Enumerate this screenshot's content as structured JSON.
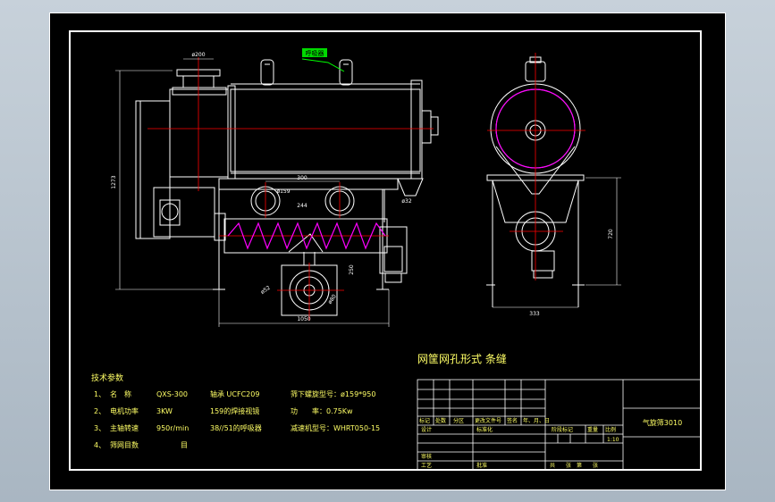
{
  "colors": {
    "background": "#000000",
    "line": "#ffffff",
    "accent": "#ff0000",
    "spiral": "#ff00ff",
    "leader": "#00ff00",
    "text": "#ffff66",
    "dim": "#00ffff",
    "window": "#b6c1cb"
  },
  "drawing": {
    "labels": {
      "top_dia": "ø200",
      "breather": "呼吸器",
      "side_height": "1273",
      "hole_spacing": "300",
      "hole_dia": "ø159",
      "inner_hole": "244",
      "right_dim": "ø32",
      "mid_dim": "250",
      "flange_dia": "ø52",
      "flange_dia2": "ø80",
      "bottom_length": "1050",
      "leg_height": "720",
      "width_dim": "333"
    },
    "screen_form": "网筐网孔形式   条缝"
  },
  "specs": {
    "title": "技术参数",
    "rows": [
      {
        "num": "1、",
        "label": "名　称",
        "value": "QXS-300",
        "extra": "轴承 UCFC209",
        "extra2": "筛下螺旋型号：ø159*950"
      },
      {
        "num": "2、",
        "label": "电机功率",
        "value": "3KW",
        "extra": "159的焊接视镜",
        "extra2": "功　　率：0.75Kw"
      },
      {
        "num": "3、",
        "label": "主轴转速",
        "value": "950r/min",
        "extra": "38//51的呼吸器",
        "extra2": "减速机型号：WHRT050-15"
      },
      {
        "num": "4、",
        "label": "筛网目数",
        "value": "目",
        "extra": "",
        "extra2": ""
      }
    ]
  },
  "titleblock": {
    "product": "气旋筛3010",
    "row_labels": [
      "标记",
      "处数",
      "分区",
      "更改文件号",
      "签名",
      "年、月、日"
    ],
    "design": "设计",
    "standard": "标准化",
    "review": "审核",
    "process": "工艺",
    "approve": "批准",
    "stage": "阶段标记",
    "weight": "重量",
    "scale": "比例",
    "scale_value": "1:10",
    "sheets": "共　　张　第　　张"
  }
}
